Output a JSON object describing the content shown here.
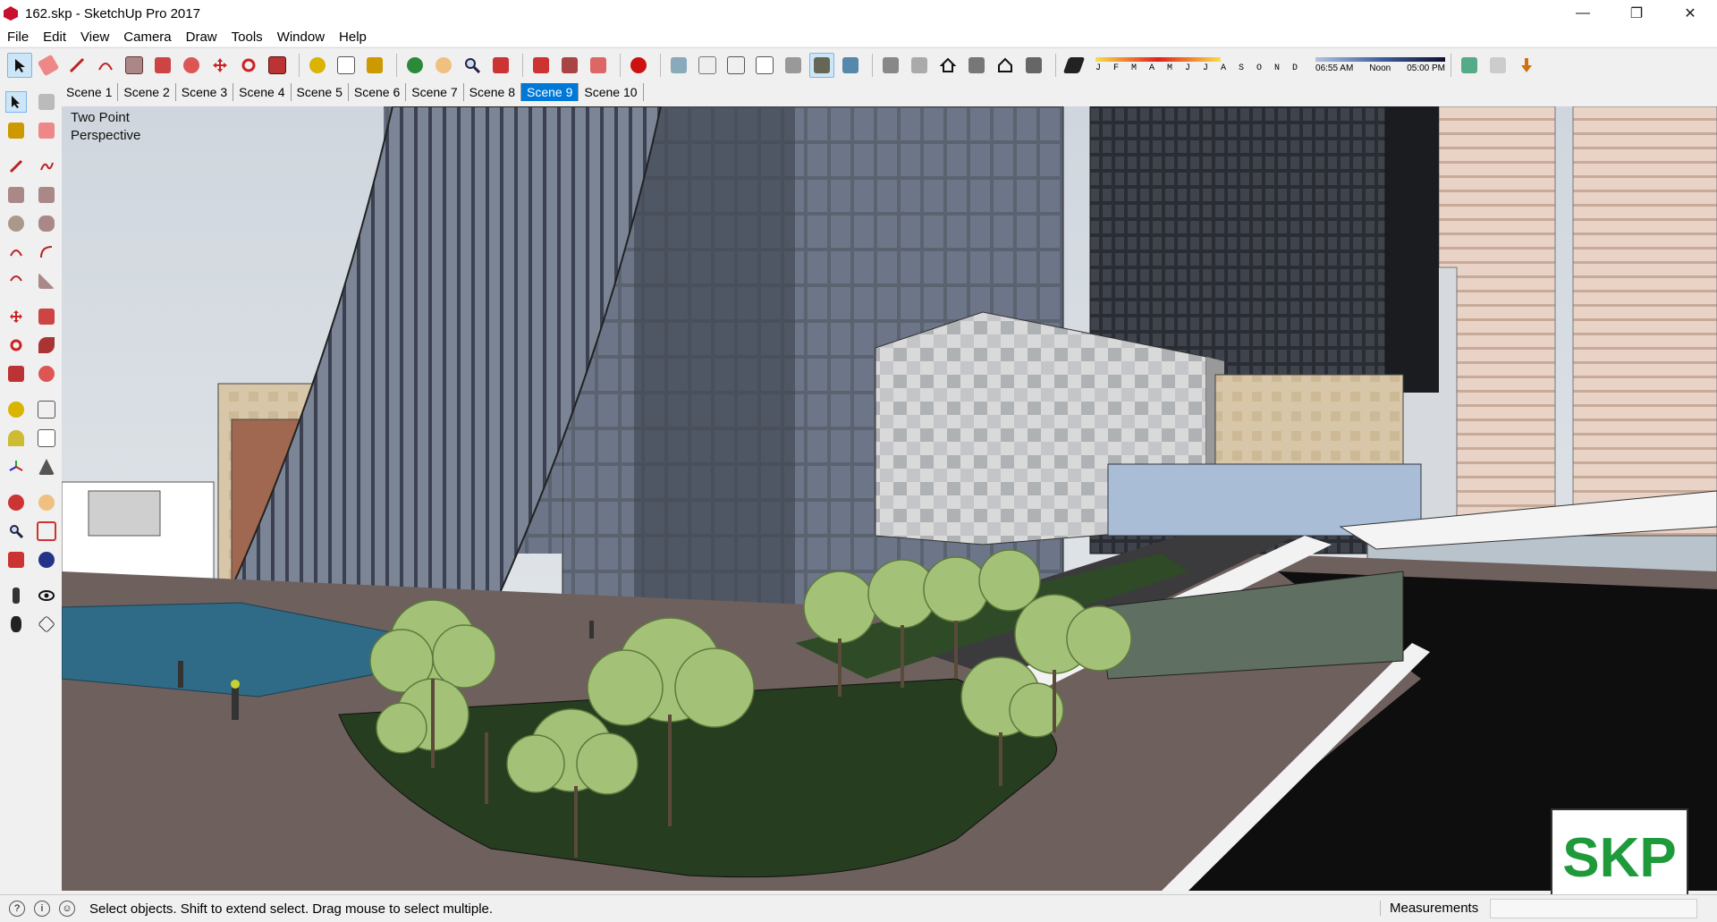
{
  "window": {
    "title": "162.skp - SketchUp Pro 2017",
    "minimize": "—",
    "maximize": "❐",
    "close": "✕"
  },
  "menu": [
    "File",
    "Edit",
    "View",
    "Camera",
    "Draw",
    "Tools",
    "Window",
    "Help"
  ],
  "shadow_settings": {
    "months": "J F M A M J J A S O N D",
    "time_start": "06:55 AM",
    "time_noon": "Noon",
    "time_end": "05:00 PM"
  },
  "scenes": [
    "Scene 1",
    "Scene 2",
    "Scene 3",
    "Scene 4",
    "Scene 5",
    "Scene 6",
    "Scene 7",
    "Scene 8",
    "Scene 9",
    "Scene 10"
  ],
  "active_scene": "Scene 9",
  "viewport": {
    "camera_label": "Two Point\nPerspective",
    "logo_text": "SKP"
  },
  "status": {
    "message": "Select objects. Shift to extend select. Drag mouse to select multiple.",
    "measurements_label": "Measurements",
    "measurements_value": ""
  },
  "colors": {
    "accent": "#0078d7",
    "logo_green": "#1f9a3a"
  }
}
